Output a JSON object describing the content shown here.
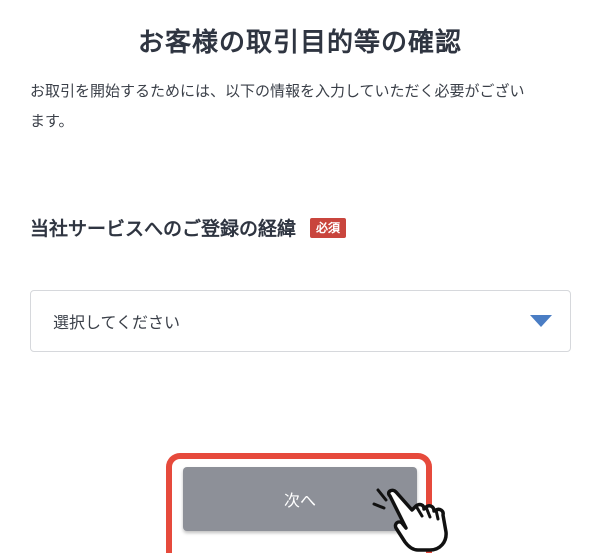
{
  "header": {
    "title": "お客様の取引目的等の確認"
  },
  "intro": {
    "line1": "お取引を開始するためには、以下の情報を入力していただく必要がござい",
    "line2": "ます。"
  },
  "registration_route": {
    "label": "当社サービスへのご登録の経緯",
    "required_badge": "必須",
    "select_value": "選択してください"
  },
  "actions": {
    "next_label": "次へ"
  },
  "icons": {
    "dropdown": "chevron-down-icon",
    "cursor": "hand-pointer-icon"
  },
  "colors": {
    "badge": "#c9453d",
    "chevron": "#4a7dc4",
    "highlight": "#e64a3c",
    "button": "#8d9098"
  }
}
